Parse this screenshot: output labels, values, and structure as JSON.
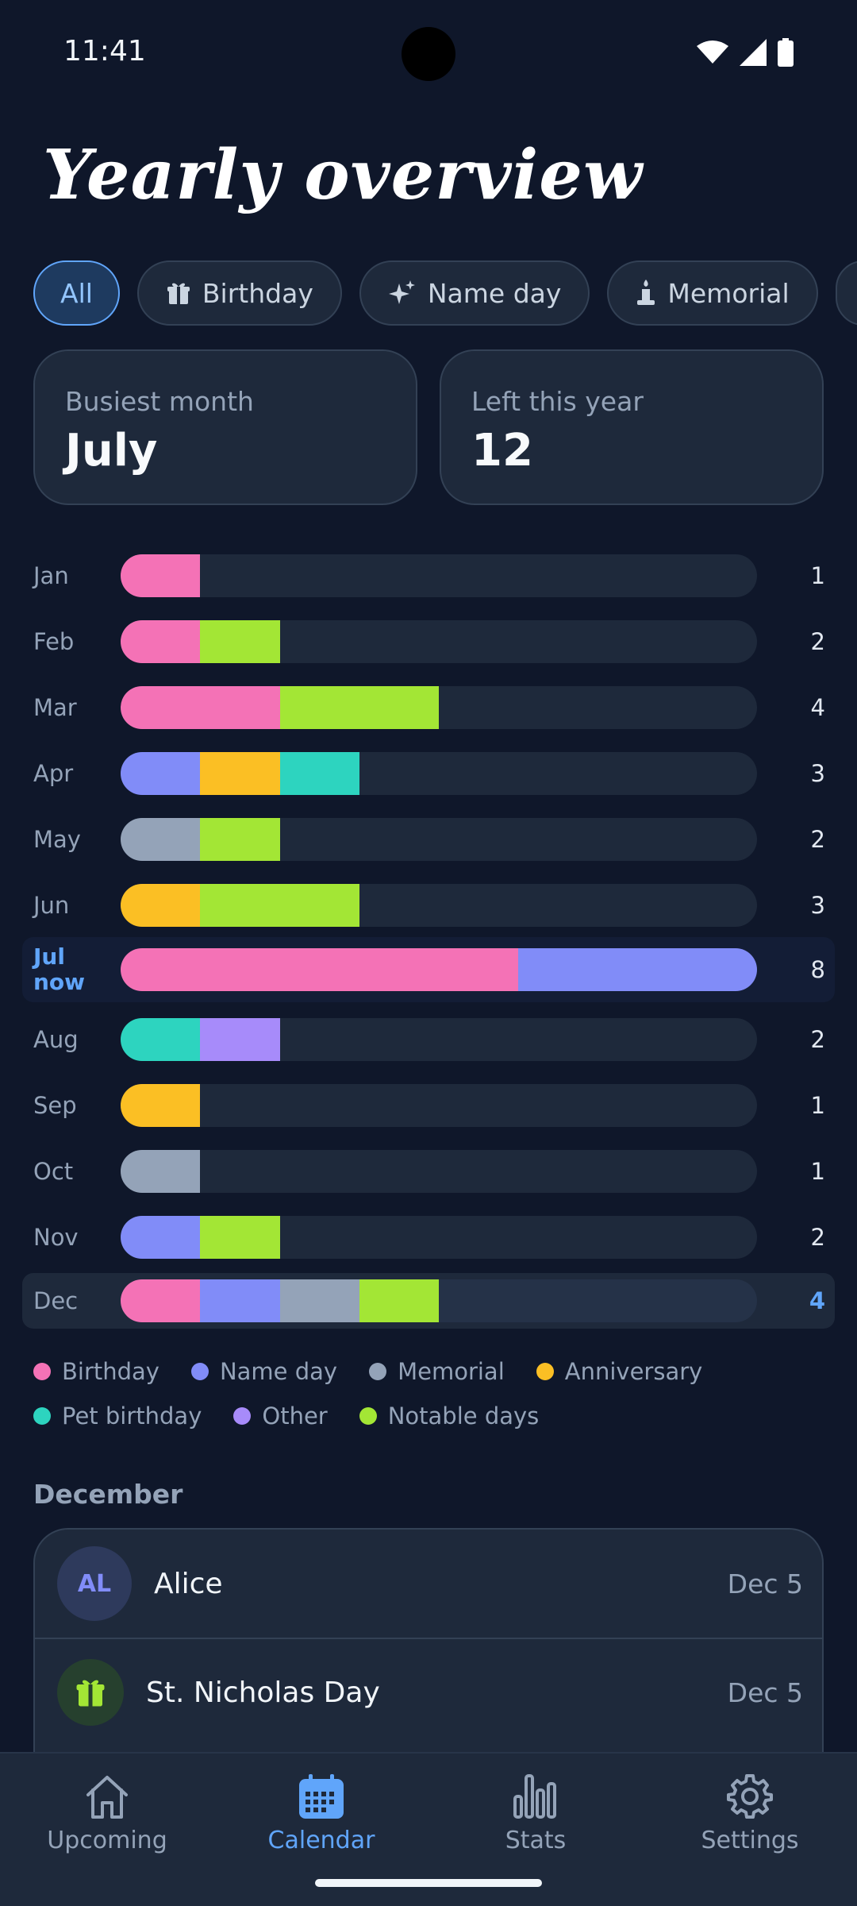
{
  "status_bar": {
    "time": "11:41"
  },
  "page_title": "Yearly overview",
  "filters": [
    {
      "label": "All",
      "icon": "none",
      "active": true
    },
    {
      "label": "Birthday",
      "icon": "gift-icon"
    },
    {
      "label": "Name day",
      "icon": "sparkles-icon"
    },
    {
      "label": "Memorial",
      "icon": "candle-icon"
    }
  ],
  "summary": {
    "busiest_label": "Busiest month",
    "busiest_value": "July",
    "left_label": "Left this year",
    "left_value": "12"
  },
  "colors": {
    "birthday": "#f472b6",
    "name_day": "#818cf8",
    "memorial": "#94a3b8",
    "anniversary": "#fbbf24",
    "pet_birthday": "#2dd4bf",
    "other": "#a78bfa",
    "notable": "#a3e635",
    "accent": "#60a5fa"
  },
  "chart_data": {
    "type": "bar",
    "orientation": "horizontal",
    "stacked": true,
    "max_units": 8,
    "categories": [
      "Jan",
      "Feb",
      "Mar",
      "Apr",
      "May",
      "Jun",
      "Jul",
      "Aug",
      "Sep",
      "Oct",
      "Nov",
      "Dec"
    ],
    "current_month_suffix": "now",
    "current_index": 6,
    "selected_index": 11,
    "series_keys": [
      "birthday",
      "name_day",
      "memorial",
      "anniversary",
      "pet_birthday",
      "other",
      "notable"
    ],
    "rows": [
      {
        "label": "Jan",
        "total": "1",
        "segments": [
          [
            "birthday",
            1
          ]
        ]
      },
      {
        "label": "Feb",
        "total": "2",
        "segments": [
          [
            "birthday",
            1
          ],
          [
            "notable",
            1
          ]
        ]
      },
      {
        "label": "Mar",
        "total": "4",
        "segments": [
          [
            "birthday",
            2
          ],
          [
            "notable",
            2
          ]
        ]
      },
      {
        "label": "Apr",
        "total": "3",
        "segments": [
          [
            "name_day",
            1
          ],
          [
            "anniversary",
            1
          ],
          [
            "pet_birthday",
            1
          ]
        ]
      },
      {
        "label": "May",
        "total": "2",
        "segments": [
          [
            "memorial",
            1
          ],
          [
            "notable",
            1
          ]
        ]
      },
      {
        "label": "Jun",
        "total": "3",
        "segments": [
          [
            "anniversary",
            1
          ],
          [
            "notable",
            2
          ]
        ]
      },
      {
        "label": "Jul",
        "total": "8",
        "segments": [
          [
            "birthday",
            5
          ],
          [
            "name_day",
            3
          ]
        ]
      },
      {
        "label": "Aug",
        "total": "2",
        "segments": [
          [
            "pet_birthday",
            1
          ],
          [
            "other",
            1
          ]
        ]
      },
      {
        "label": "Sep",
        "total": "1",
        "segments": [
          [
            "anniversary",
            1
          ]
        ]
      },
      {
        "label": "Oct",
        "total": "1",
        "segments": [
          [
            "memorial",
            1
          ]
        ]
      },
      {
        "label": "Nov",
        "total": "2",
        "segments": [
          [
            "name_day",
            1
          ],
          [
            "notable",
            1
          ]
        ]
      },
      {
        "label": "Dec",
        "total": "4",
        "segments": [
          [
            "birthday",
            1
          ],
          [
            "name_day",
            1
          ],
          [
            "memorial",
            1
          ],
          [
            "notable",
            1
          ]
        ]
      }
    ]
  },
  "legend": [
    {
      "key": "birthday",
      "label": "Birthday"
    },
    {
      "key": "name_day",
      "label": "Name day"
    },
    {
      "key": "memorial",
      "label": "Memorial"
    },
    {
      "key": "anniversary",
      "label": "Anniversary"
    },
    {
      "key": "pet_birthday",
      "label": "Pet birthday"
    },
    {
      "key": "other",
      "label": "Other"
    },
    {
      "key": "notable",
      "label": "Notable days"
    }
  ],
  "section_title": "December",
  "events": [
    {
      "initials": "AL",
      "name": "Alice",
      "date": "Dec 5"
    },
    {
      "icon": "gift-icon",
      "name": "St. Nicholas Day",
      "date": "Dec 5"
    }
  ],
  "nav": [
    {
      "label": "Upcoming",
      "icon": "home-icon"
    },
    {
      "label": "Calendar",
      "icon": "calendar-icon",
      "active": true
    },
    {
      "label": "Stats",
      "icon": "bar-chart-icon"
    },
    {
      "label": "Settings",
      "icon": "gear-icon"
    }
  ]
}
